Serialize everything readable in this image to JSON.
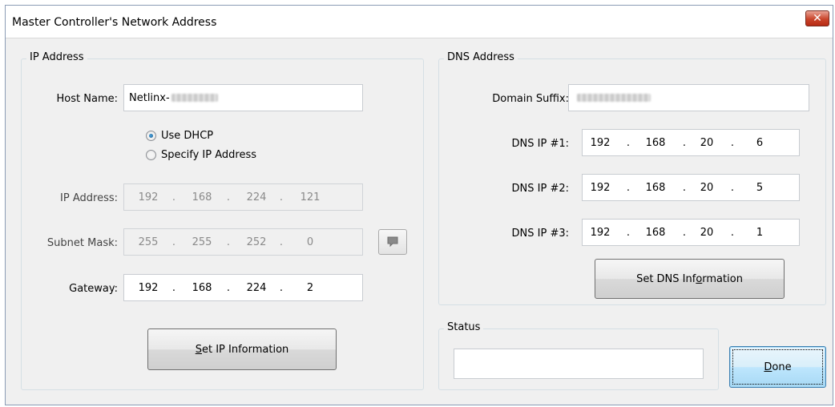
{
  "window": {
    "title": "Master Controller's Network Address",
    "close_glyph": "✕"
  },
  "ip_group": {
    "legend": "IP Address",
    "host_name_label": "Host Name:",
    "host_name_value": "Netlinx-",
    "use_dhcp_label": "Use DHCP",
    "use_dhcp_checked": true,
    "specify_ip_label": "Specify IP Address",
    "ip_address_label": "IP Address:",
    "ip_address": [
      "192",
      "168",
      "224",
      "121"
    ],
    "subnet_mask_label": "Subnet Mask:",
    "subnet_mask": [
      "255",
      "255",
      "252",
      "0"
    ],
    "gateway_label": "Gateway:",
    "gateway": [
      "192",
      "168",
      "224",
      "2"
    ],
    "set_ip_button_prefix": "S",
    "set_ip_button_rest": "et IP Information"
  },
  "dns_group": {
    "legend": "DNS Address",
    "domain_suffix_label": "Domain Suffix:",
    "dns1_label": "DNS IP #1:",
    "dns1": [
      "192",
      "168",
      "20",
      "6"
    ],
    "dns2_label": "DNS IP #2:",
    "dns2": [
      "192",
      "168",
      "20",
      "5"
    ],
    "dns3_label": "DNS IP #3:",
    "dns3": [
      "192",
      "168",
      "20",
      "1"
    ],
    "set_dns_button_prefix": "Set DNS Inf",
    "set_dns_button_mnemonic": "o",
    "set_dns_button_suffix": "rmation"
  },
  "status_group": {
    "legend": "Status",
    "value": ""
  },
  "done_button": {
    "mnemonic": "D",
    "rest": "one"
  },
  "icons": {
    "close": "close-icon",
    "note": "note-icon"
  },
  "colors": {
    "close_button": "#c9452b",
    "window_bg": "#f0f0f0",
    "focus_blue": "#3c7fb1"
  }
}
